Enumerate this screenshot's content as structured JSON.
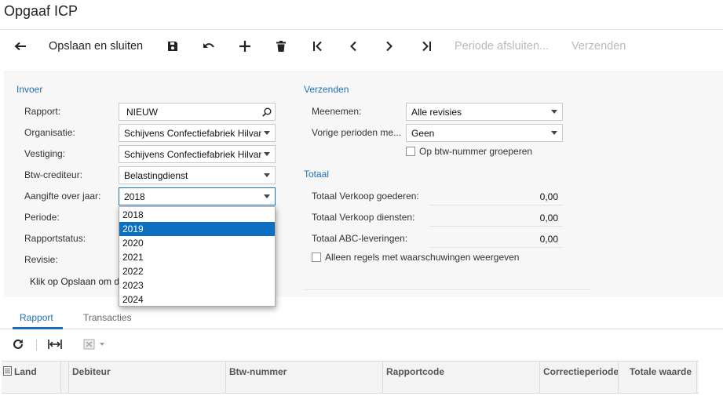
{
  "page": {
    "title": "Opgaaf ICP"
  },
  "toolbar": {
    "back_icon": "arrow-left-icon",
    "save_close_label": "Opslaan en sluiten",
    "save_icon": "floppy-disk-icon",
    "undo_icon": "undo-icon",
    "add_icon": "plus-icon",
    "delete_icon": "trash-icon",
    "first_icon": "first-record-icon",
    "prev_icon": "chevron-left-icon",
    "next_icon": "chevron-right-icon",
    "last_icon": "last-record-icon",
    "close_period_label": "Periode afsluiten...",
    "send_label": "Verzenden"
  },
  "form": {
    "invoer": {
      "title": "Invoer",
      "rapport_label": "Rapport:",
      "rapport_value": "NIEUW",
      "organisatie_label": "Organisatie:",
      "organisatie_value": "Schijvens Confectiefabriek Hilvarenbeek",
      "vestiging_label": "Vestiging:",
      "vestiging_value": "Schijvens Confectiefabriek Hilvarenbeek",
      "crediteur_label": "Btw-crediteur:",
      "crediteur_value": "Belastingdienst",
      "jaar_label": "Aangifte over jaar:",
      "jaar_value": "2018",
      "periode_label": "Periode:",
      "status_label": "Rapportstatus:",
      "revisie_label": "Revisie:",
      "hint": "Klik op Opslaan om de rapportage aan te maken."
    },
    "verzenden": {
      "title": "Verzenden",
      "meenemen_label": "Meenemen:",
      "meenemen_value": "Alle revisies",
      "vorige_label": "Vorige perioden me...",
      "vorige_value": "Geen",
      "group_checkbox": "Op btw-nummer groeperen"
    },
    "totaal": {
      "title": "Totaal",
      "verkoop_goederen_label": "Totaal Verkoop goederen:",
      "verkoop_goederen_value": "0,00",
      "verkoop_diensten_label": "Totaal Verkoop diensten:",
      "verkoop_diensten_value": "0,00",
      "abc_label": "Totaal ABC-leveringen:",
      "abc_value": "0,00",
      "warnings_checkbox": "Alleen regels met waarschuwingen weergeven"
    }
  },
  "year_dropdown": {
    "options": [
      "2018",
      "2019",
      "2020",
      "2021",
      "2022",
      "2023",
      "2024"
    ],
    "highlighted": "2019"
  },
  "tabs": [
    {
      "label": "Rapport",
      "active": true
    },
    {
      "label": "Transacties",
      "active": false
    }
  ],
  "grid_toolbar": {
    "refresh_icon": "refresh-icon",
    "fit_icon": "fit-columns-icon",
    "export_icon": "excel-export-icon"
  },
  "grid": {
    "columns": [
      "Land",
      "Debiteur",
      "Btw-nummer",
      "Rapportcode",
      "Correctieperiode",
      "Totale waarde"
    ]
  },
  "colors": {
    "accent": "#1f6fb5",
    "selection": "#0d6fbf",
    "disabled": "#b9b9b9"
  }
}
